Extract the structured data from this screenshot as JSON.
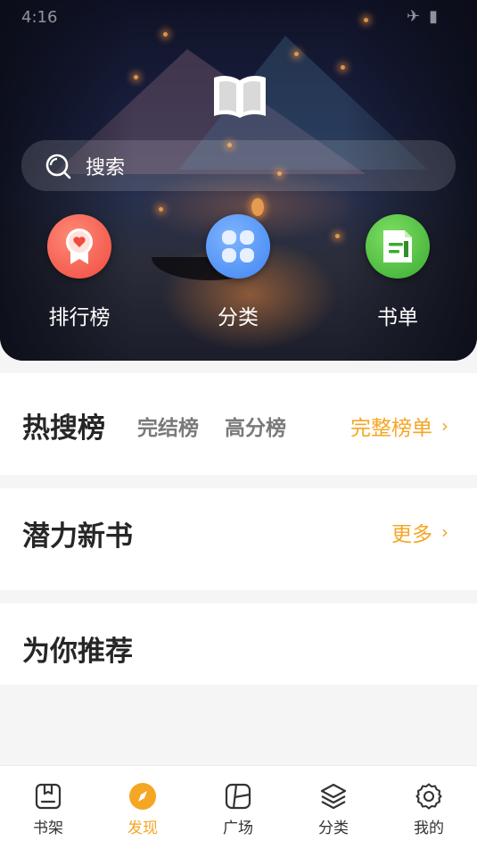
{
  "status_bar": {
    "time": "4:16"
  },
  "header": {
    "search": {
      "placeholder": "搜索"
    },
    "quick_links": [
      {
        "label": "排行榜",
        "icon": "rank-badge-icon",
        "color": "#ef4b3e"
      },
      {
        "label": "分类",
        "icon": "category-grid-icon",
        "color": "#3f86f2"
      },
      {
        "label": "书单",
        "icon": "booklist-icon",
        "color": "#3aaa32"
      }
    ]
  },
  "sections": {
    "hot": {
      "title": "热搜榜",
      "tabs": [
        "完结榜",
        "高分榜"
      ],
      "more": "完整榜单"
    },
    "new_books": {
      "title": "潜力新书",
      "more": "更多"
    },
    "recommend": {
      "title": "为你推荐"
    }
  },
  "bottom_nav": {
    "items": [
      {
        "label": "书架",
        "icon": "bookshelf-icon"
      },
      {
        "label": "发现",
        "icon": "compass-icon",
        "active": true
      },
      {
        "label": "广场",
        "icon": "square-icon"
      },
      {
        "label": "分类",
        "icon": "layers-icon"
      },
      {
        "label": "我的",
        "icon": "gear-icon"
      }
    ]
  },
  "colors": {
    "accent": "#f5a623",
    "title": "#262626",
    "sub_tab": "#7a7a7a"
  }
}
